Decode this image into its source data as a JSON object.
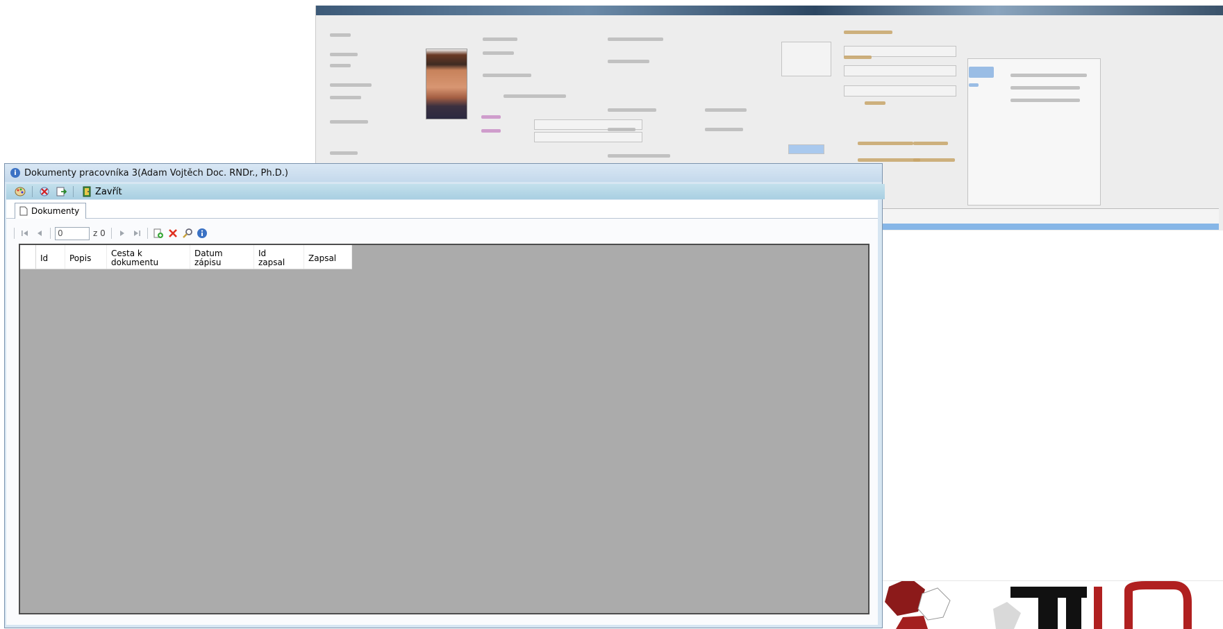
{
  "window": {
    "title": "Dokumenty pracovníka 3(Adam Vojtěch Doc. RNDr., Ph.D.)",
    "title_icon": "info-icon"
  },
  "toolbar": {
    "icons": [
      "palette-icon",
      "delete-filter-icon",
      "export-icon",
      "exit-door-icon"
    ],
    "close_label": "Zavřít"
  },
  "tabs": [
    {
      "label": "Dokumenty",
      "icon": "document-icon",
      "selected": true
    }
  ],
  "navigator": {
    "position_value": "0",
    "count_text": "z 0",
    "icons": [
      "first-record-icon",
      "prev-record-icon",
      "next-record-icon",
      "last-record-icon",
      "add-icon",
      "delete-icon",
      "edit-icon",
      "info-icon"
    ]
  },
  "grid": {
    "columns": [
      "Id",
      "Popis",
      "Cesta k\ndokumentu",
      "Datum\nzápisu",
      "Id\nzapsal",
      "Zapsal"
    ],
    "rows": []
  },
  "colors": {
    "title_bar": "#c4d9ec",
    "toolbar": "#a9cfe2",
    "grid_background": "#ababab",
    "delete_red": "#e03020",
    "info_blue": "#3b72c4"
  }
}
